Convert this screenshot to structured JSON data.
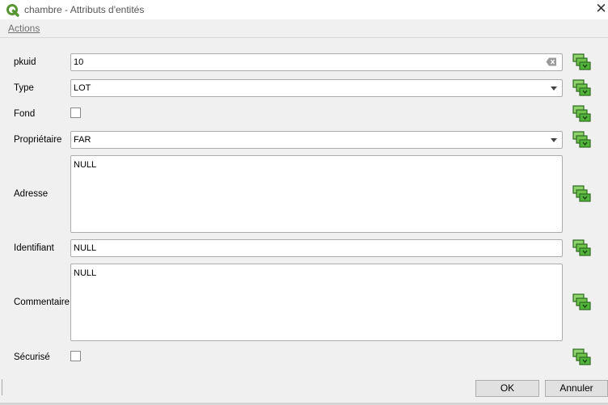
{
  "window": {
    "title": "chambre - Attributs d'entités",
    "close_glyph": "✕"
  },
  "menu": {
    "actions_label": "Actions"
  },
  "fields": {
    "pkuid": {
      "label": "pkuid",
      "value": "10"
    },
    "type": {
      "label": "Type",
      "value": "LOT"
    },
    "fond": {
      "label": "Fond",
      "checked": false
    },
    "proprietaire": {
      "label": "Propriétaire",
      "value": "FAR"
    },
    "adresse": {
      "label": "Adresse",
      "value": "NULL"
    },
    "identifiant": {
      "label": "Identifiant",
      "value": "NULL"
    },
    "commentaire": {
      "label": "Commentaire",
      "value": "NULL"
    },
    "securise": {
      "label": "Sécurisé",
      "checked": false
    }
  },
  "buttons": {
    "ok": "OK",
    "cancel": "Annuler"
  },
  "colors": {
    "qgis_green": "#589632",
    "dd_green": "#52b43c",
    "dd_dark": "#2d6a1e"
  }
}
